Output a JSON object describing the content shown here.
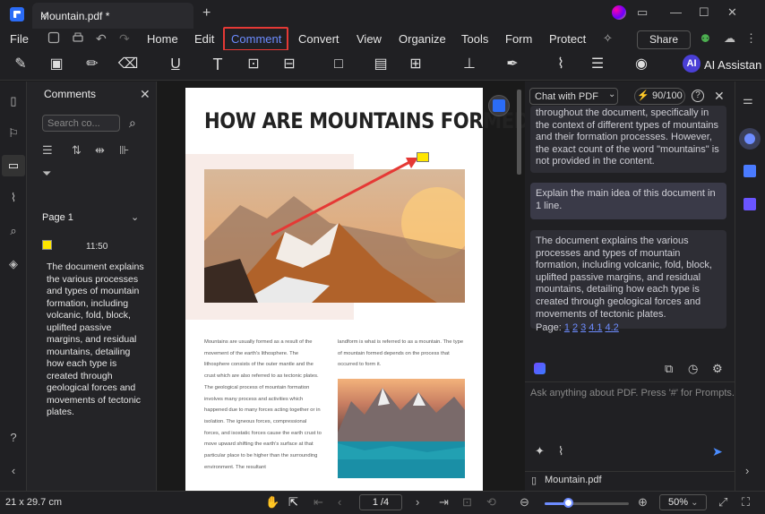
{
  "titlebar": {
    "tab_title": "Mountain.pdf *",
    "tab_close": "×",
    "new_tab": "+",
    "min": "—",
    "max": "☐",
    "close": "✕"
  },
  "menu": {
    "file": "File",
    "home": "Home",
    "edit": "Edit",
    "comment": "Comment",
    "convert": "Convert",
    "view": "View",
    "organize": "Organize",
    "tools": "Tools",
    "form": "Form",
    "protect": "Protect",
    "share": "Share"
  },
  "toolbar": {
    "ai_badge": "AI",
    "ai_label": "AI Assistan"
  },
  "comments": {
    "title": "Comments",
    "search_placeholder": "Search co...",
    "page_label": "Page 1",
    "time": "11:50",
    "text": "The document explains the various processes and types of mountain formation, including volcanic, fold, block, uplifted passive margins, and residual mountains, detailing how each type is created through geological forces and movements of tectonic plates."
  },
  "document": {
    "title": "HOW ARE MOUNTAINS FORMED?",
    "col1": "Mountains are usually formed as a result of the movement of the earth's lithosphere. The lithosphere consists of the outer mantle and the crust which are also referred to as tectonic plates. The geological process of mountain formation involves many process and activities which happened due to many forces acting together or in isolation. The igneous forces, compressional forces, and isostatic forces cause the earth crust to move upward shifting the earth's surface at that particular place to be higher than the surrounding environment. The resultant",
    "col2": "landform is what is referred to as a mountain. The type of mountain formed depends on the process that occurred to form it."
  },
  "ai": {
    "mode": "Chat with PDF",
    "tokens": "90/100",
    "answer1": "throughout the document, specifically in the context of different types of mountains and their formation processes. However, the exact count of the word \"mountains\" is not provided in the content.",
    "question": "Explain the main idea of this document in 1 line.",
    "answer2": "The document explains the various processes and types of mountain formation, including volcanic, fold, block, uplifted passive margins, and residual mountains, detailing how each type is created through geological forces and movements of tectonic plates.",
    "pages_label": "Page:",
    "pages": [
      "1",
      "2",
      "3",
      "4.1",
      "4.2"
    ],
    "ask_placeholder": "Ask anything about PDF. Press '#' for Prompts.",
    "file_name": "Mountain.pdf"
  },
  "status": {
    "dims": "21 x 29.7 cm",
    "page": "1 /4",
    "zoom": "50%",
    "zoom_fraction": 0.3
  },
  "colors": {
    "accent": "#6d8cff",
    "highlight_border": "#e53935",
    "sticky_note": "#ffe600",
    "arrow": "#e53935"
  }
}
